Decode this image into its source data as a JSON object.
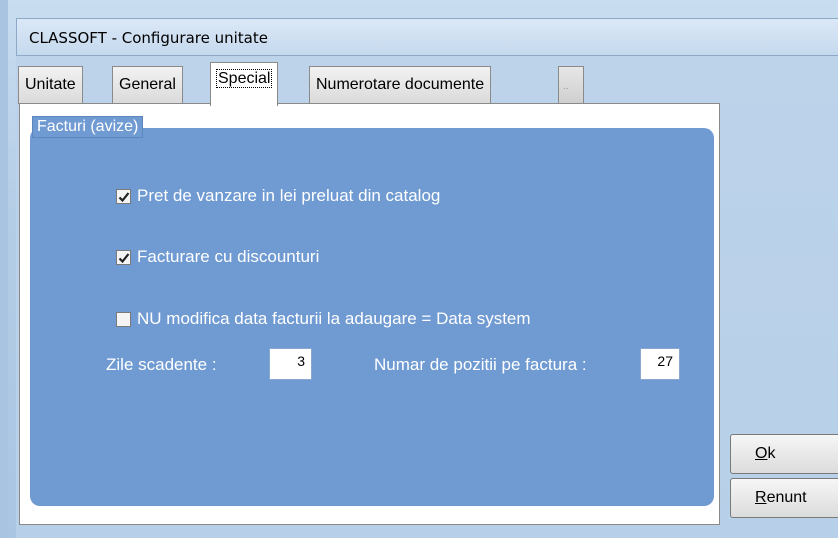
{
  "window": {
    "title": "CLASSOFT - Configurare unitate"
  },
  "tabs": [
    {
      "label": "Unitate"
    },
    {
      "label": "General"
    },
    {
      "label": "Special",
      "active": true
    },
    {
      "label": "Numerotare documente"
    },
    {
      "label": ".."
    }
  ],
  "group": {
    "legend": "Facturi (avize)"
  },
  "options": [
    {
      "label": "Pret de vanzare in lei preluat din catalog",
      "checked": true
    },
    {
      "label": "Facturare cu discounturi",
      "checked": true
    },
    {
      "label": "NU modifica data facturii la adaugare = Data system",
      "checked": false
    }
  ],
  "fields": {
    "zile_label": "Zile scadente  :",
    "zile_value": "3",
    "pozitii_label": "Numar de pozitii pe factura :",
    "pozitii_value": "27"
  },
  "buttons": {
    "ok_underline": "O",
    "ok_rest": "k",
    "renunt_underline": "R",
    "renunt_rest": "enunt"
  }
}
